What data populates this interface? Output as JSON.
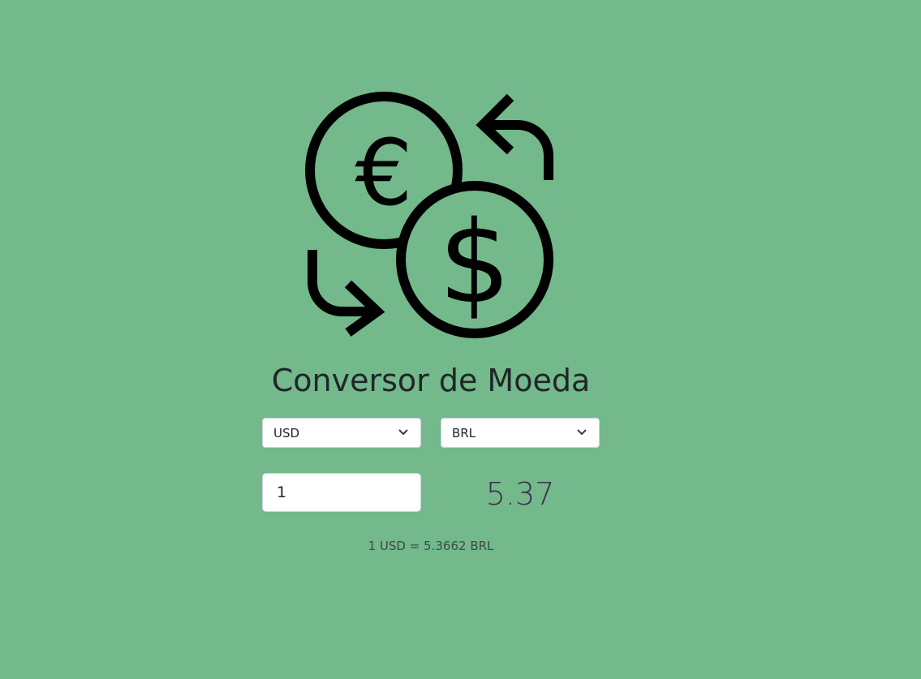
{
  "app": {
    "title": "Conversor de Moeda",
    "logo_icon": "currency-exchange-icon"
  },
  "converter": {
    "from_currency": "USD",
    "to_currency": "BRL",
    "amount": "1",
    "result": "5.37",
    "rate_text": "1 USD = 5.3662 BRL"
  },
  "colors": {
    "background": "#73b98b",
    "result_text": "#3a2f4f"
  }
}
